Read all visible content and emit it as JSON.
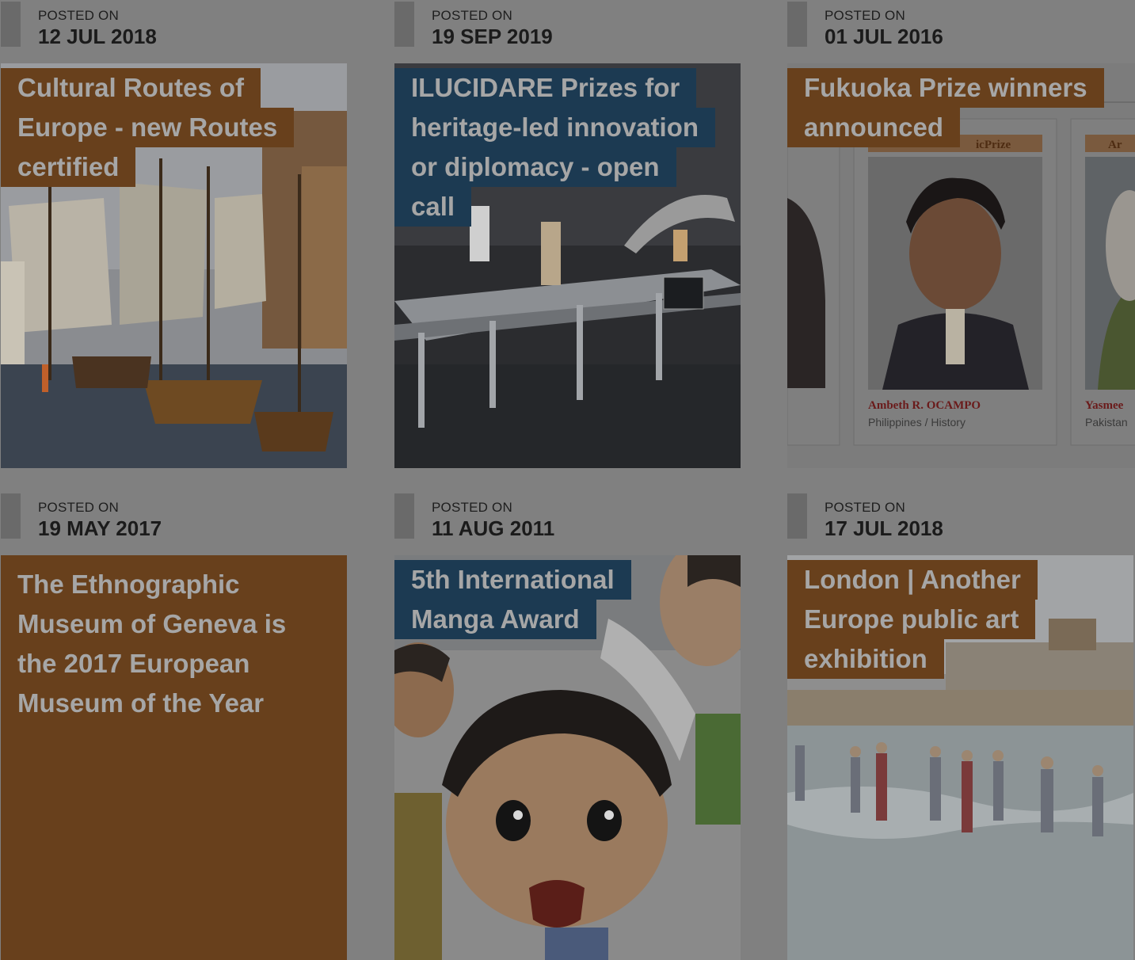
{
  "posts": [
    {
      "label": "POSTED ON",
      "date": "12 JUL 2018",
      "title_lines": [
        "Cultural Routes of",
        "Europe - new Routes",
        "certified"
      ],
      "accent": "#68401c",
      "image_icon": "tall-ships-image"
    },
    {
      "label": "POSTED ON",
      "date": "19 SEP 2019",
      "title_lines": [
        "ILUCIDARE Prizes for",
        "heritage-led innovation",
        "or diplomacy - open",
        "call"
      ],
      "accent": "#1c3a52",
      "image_icon": "lab-scanner-image"
    },
    {
      "label": "POSTED ON",
      "date": "01 JUL 2016",
      "title_lines": [
        "Fukuoka Prize winners",
        "announced"
      ],
      "accent": "#68401c",
      "image_icon": "prize-winners-image",
      "image_text": {
        "banner_left": "icPrize",
        "banner_right": "Ar",
        "winner_name": "Ambeth R. OCAMPO",
        "winner_field": "Philippines / History",
        "winner2_name": "Yasmee",
        "winner2_field": "Pakistan"
      }
    },
    {
      "label": "POSTED ON",
      "date": "19 MAY 2017",
      "title_lines": [
        "The Ethnographic",
        "Museum of Geneva is",
        "the 2017 European",
        "Museum of the Year"
      ],
      "accent": "#68401c",
      "image_icon": null
    },
    {
      "label": "POSTED ON",
      "date": "11 AUG 2011",
      "title_lines": [
        "5th International",
        "Manga Award"
      ],
      "accent": "#1c3a52",
      "image_icon": "manga-illustration-image"
    },
    {
      "label": "POSTED ON",
      "date": "17 JUL 2018",
      "title_lines": [
        "London | Another",
        "Europe public art",
        "exhibition"
      ],
      "accent": "#68401c",
      "image_icon": "beach-bathers-image"
    }
  ],
  "overlay": {
    "color": "#000000",
    "opacity": 0.5
  }
}
